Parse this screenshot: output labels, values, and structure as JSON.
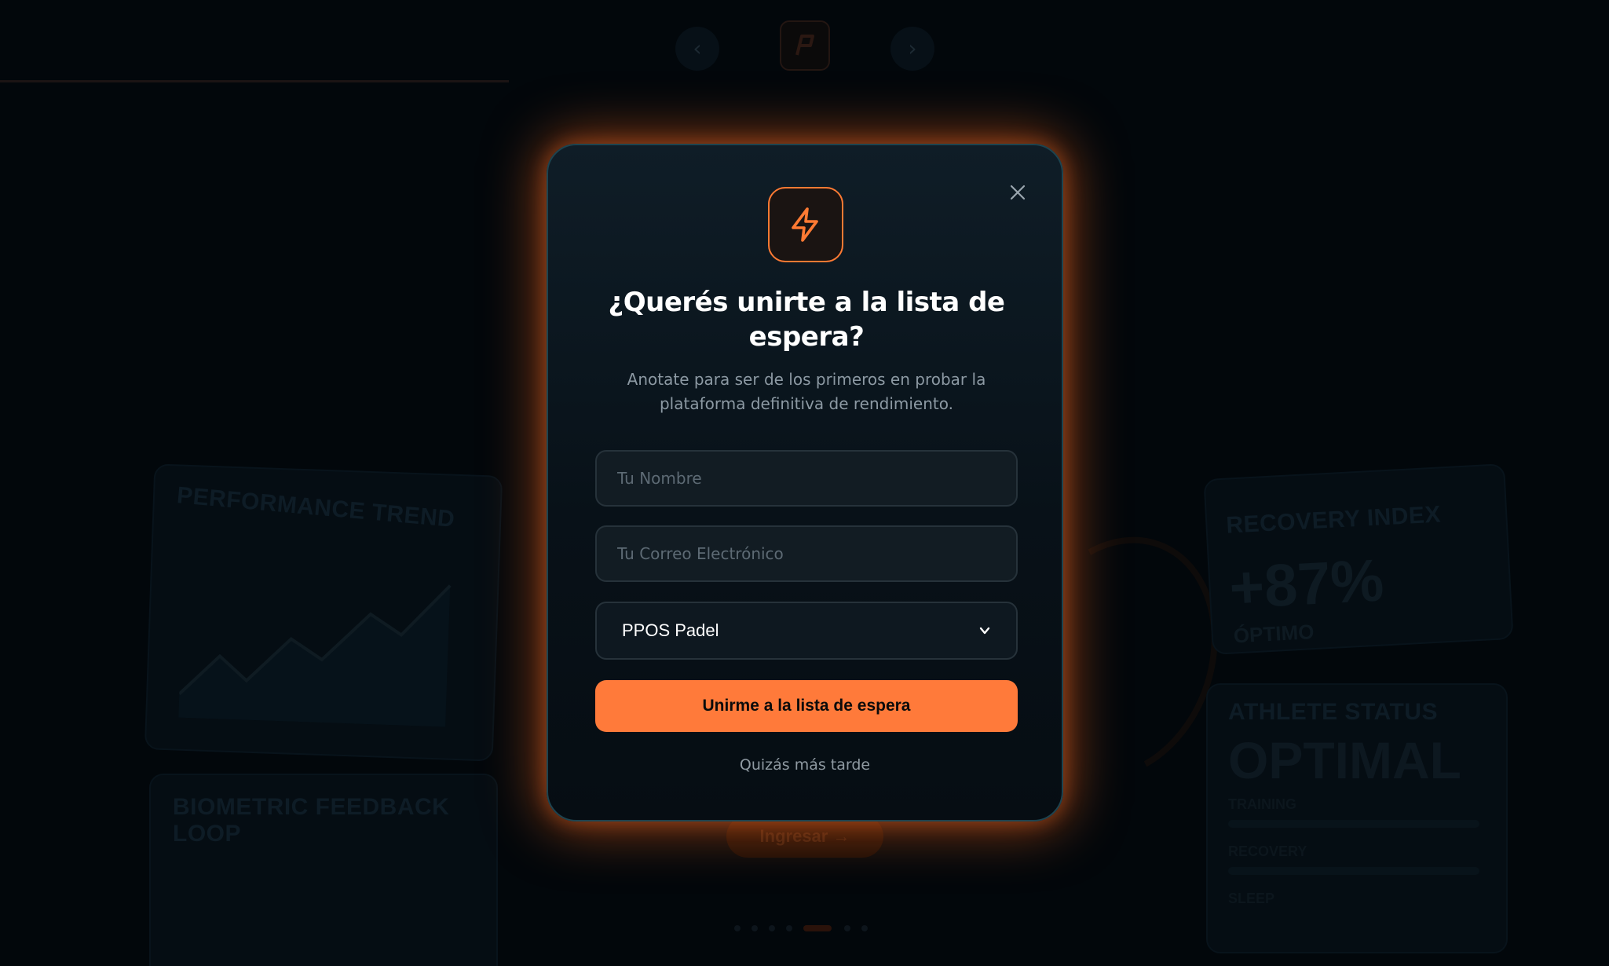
{
  "background": {
    "nav": {
      "prev_icon": "chevron-left-icon",
      "next_icon": "chevron-right-icon",
      "logo_icon": "brand-logo"
    },
    "performance_card": {
      "title": "PERFORMANCE TREND"
    },
    "biometric_card": {
      "title": "BIOMETRIC FEEDBACK LOOP"
    },
    "recovery_card": {
      "title": "RECOVERY INDEX",
      "value": "+87%",
      "status": "ÓPTIMO"
    },
    "athlete_card": {
      "title": "ATHLETE STATUS",
      "value": "OPTIMAL",
      "labels": [
        "TRAINING",
        "RECOVERY",
        "SLEEP"
      ]
    },
    "cta": {
      "label": "Ingresar →"
    }
  },
  "modal": {
    "icon": "lightning-icon",
    "title": "¿Querés unirte a la lista de espera?",
    "subtitle": "Anotate para ser de los primeros en probar la plataforma definitiva de rendimiento.",
    "name_placeholder": "Tu Nombre",
    "email_placeholder": "Tu Correo Electrónico",
    "select_value": "PPOS Padel",
    "submit_label": "Unirme a la lista de espera",
    "later_label": "Quizás más tarde",
    "close_icon": "close-icon"
  },
  "colors": {
    "accent": "#ff7a3a",
    "modal_border": "#1d4450",
    "background": "#02070b"
  }
}
